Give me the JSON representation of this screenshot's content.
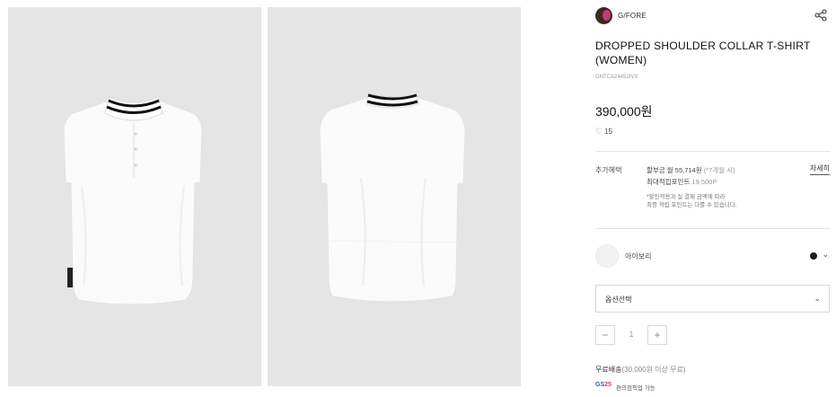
{
  "brand": {
    "name": "G/FORE",
    "avatar_icon": "brand-avatar-image"
  },
  "product": {
    "title": "DROPPED SHOULDER COLLAR T-SHIRT (WOMEN)",
    "code": "GNTCA24452IVX",
    "price": "390,000원",
    "likes_count": "15"
  },
  "benefits": {
    "label": "추가혜택",
    "installment_prefix": "할부금 월 55,714원",
    "installment_note": "(*7개월 시)",
    "points_prefix": "최대적립포인트",
    "points_value": "19,500P",
    "note_line1": "*할인적용과 실 결제 금액에 따라",
    "note_line2": "최종 적립 포인트는 다를 수 있습니다.",
    "detail_link": "자세히"
  },
  "color": {
    "name": "아이보리",
    "dot_color": "#14201c"
  },
  "option": {
    "placeholder": "옵션선택"
  },
  "quantity": {
    "minus": "−",
    "value": "1",
    "plus": "+"
  },
  "shipping": {
    "label": "무료배송",
    "detail": "(30,000원 이상 무료)",
    "gs_logo": "GS",
    "gs_logo_num": "25",
    "gs_text": "편의점픽업 가능"
  },
  "icons": {
    "share": "share-icon",
    "heart": "heart-icon",
    "chevron": "chevron-down-icon"
  }
}
